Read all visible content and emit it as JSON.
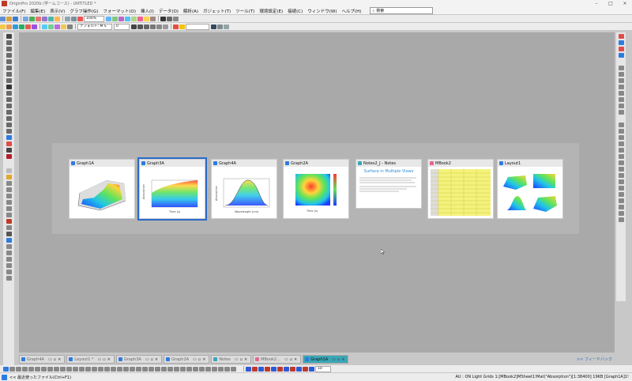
{
  "app": {
    "title": "OriginPro 2020b (学ームコース) - UNTITLED *",
    "minimize": "–",
    "maximize": "□",
    "close": "×"
  },
  "menu": {
    "items": [
      "ファイル(F)",
      "編集(E)",
      "表示(V)",
      "グラフ操作(G)",
      "フォーマット(O)",
      "挿入(I)",
      "データ(D)",
      "解析(A)",
      "ガジェット(T)",
      "ツール(T)",
      "環境設定(E)",
      "接続(C)",
      "ウィンドウ(W)",
      "ヘルプ(H)"
    ],
    "search_placeholder": "検索"
  },
  "toolbar": {
    "zoom": "100%",
    "font": "デフォルト: M S",
    "font_size": "0"
  },
  "windows": [
    {
      "name": "Graph1A",
      "type": "graph",
      "selected": false
    },
    {
      "name": "Graph3A",
      "type": "graph",
      "selected": true
    },
    {
      "name": "Graph4A",
      "type": "graph",
      "selected": false
    },
    {
      "name": "Graph2A",
      "type": "graph",
      "selected": false
    },
    {
      "name": "Notes2_J - Notes",
      "type": "notes",
      "selected": false
    },
    {
      "name": "MBook2",
      "type": "matrix",
      "selected": false
    },
    {
      "name": "Layout1",
      "type": "layout",
      "selected": false
    }
  ],
  "notes_preview": {
    "heading": "Surface in Multiple Views"
  },
  "thumbs": {
    "graph3_ylabel": "Absorption",
    "graph3_xlabel": "Time (s)",
    "graph4_ylabel": "Absorption",
    "graph4_xlabel": "Wavelength (nm)",
    "graph2_xlabel": "Time (s)"
  },
  "tabs": [
    {
      "label": "Graph4A",
      "active": false
    },
    {
      "label": "Layout1 *",
      "active": false
    },
    {
      "label": "Graph3A",
      "active": false
    },
    {
      "label": "Graph2A",
      "active": false
    },
    {
      "label": "Notes",
      "active": false
    },
    {
      "label": "MBook2...",
      "active": false
    },
    {
      "label": "Graph1A",
      "active": true
    }
  ],
  "feedback": ">> フィードバック",
  "bottom_zoom": "10",
  "status": {
    "hint": "<< 最近使ったファイル(Ctrl+F1)",
    "info": "AU : ON   Light Grids   1:[MBook2]MSheet1!Mat(\"Absorption\")[1:38400]   19KB   [Graph1A]1!"
  },
  "colors": {
    "accent": "#2b6bc9",
    "active_tab": "#3aa6b6",
    "workspace": "#a9a9a9"
  }
}
